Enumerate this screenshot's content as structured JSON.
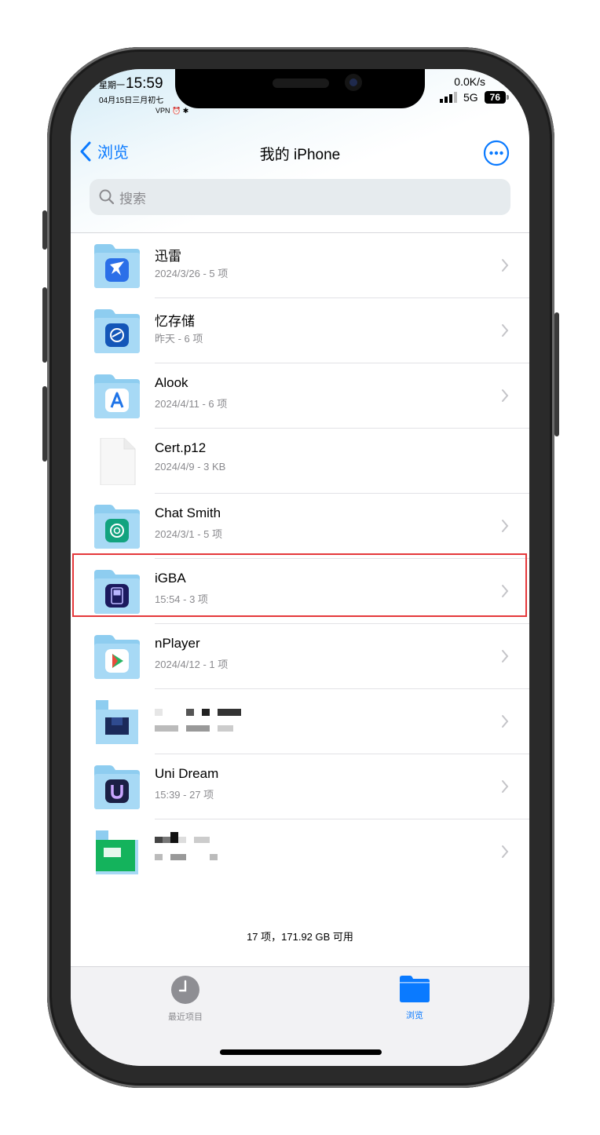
{
  "status": {
    "weekday": "星期一",
    "time": "15:59",
    "date": "04月15日三月初七",
    "indicators": "VPN ⏰ ✱",
    "net_speed": "0.0K/s",
    "network": "5G",
    "battery": "76"
  },
  "nav": {
    "back_label": "浏览",
    "title": "我的 iPhone"
  },
  "search": {
    "placeholder": "搜索"
  },
  "files": [
    {
      "name": "迅雷",
      "meta": "2024/3/26 - 5 项",
      "icon": "xunlei-folder-icon",
      "folder": true
    },
    {
      "name": "忆存储",
      "meta": "昨天 - 6 项",
      "icon": "yicunchu-folder-icon",
      "folder": true
    },
    {
      "name": "Alook",
      "meta": "2024/4/11 - 6 项",
      "icon": "alook-folder-icon",
      "folder": true
    },
    {
      "name": "Cert.p12",
      "meta": "2024/4/9 - 3 KB",
      "icon": "document-icon",
      "folder": false
    },
    {
      "name": "Chat Smith",
      "meta": "2024/3/1 - 5 项",
      "icon": "chat-smith-folder-icon",
      "folder": true
    },
    {
      "name": "iGBA",
      "meta": "15:54 - 3 项",
      "icon": "igba-folder-icon",
      "folder": true,
      "selected": true
    },
    {
      "name": "nPlayer",
      "meta": "2024/4/12 - 1 项",
      "icon": "nplayer-folder-icon",
      "folder": true
    },
    {
      "name": "",
      "meta": "",
      "icon": "pixelated-folder-icon",
      "folder": true,
      "redacted": true
    },
    {
      "name": "Uni Dream",
      "meta": "15:39 - 27 项",
      "icon": "uni-dream-folder-icon",
      "folder": true
    },
    {
      "name": "",
      "meta": "",
      "icon": "pixelated-folder-icon",
      "folder": true,
      "redacted": true
    }
  ],
  "footer": {
    "summary": "17 项，171.92 GB 可用"
  },
  "tabs": [
    {
      "label": "最近项目",
      "icon": "clock-icon"
    },
    {
      "label": "浏览",
      "icon": "folder-icon"
    }
  ],
  "colors": {
    "accent": "#0a7aff",
    "folder": "#8ecdf0",
    "selection": "#e5383b"
  }
}
